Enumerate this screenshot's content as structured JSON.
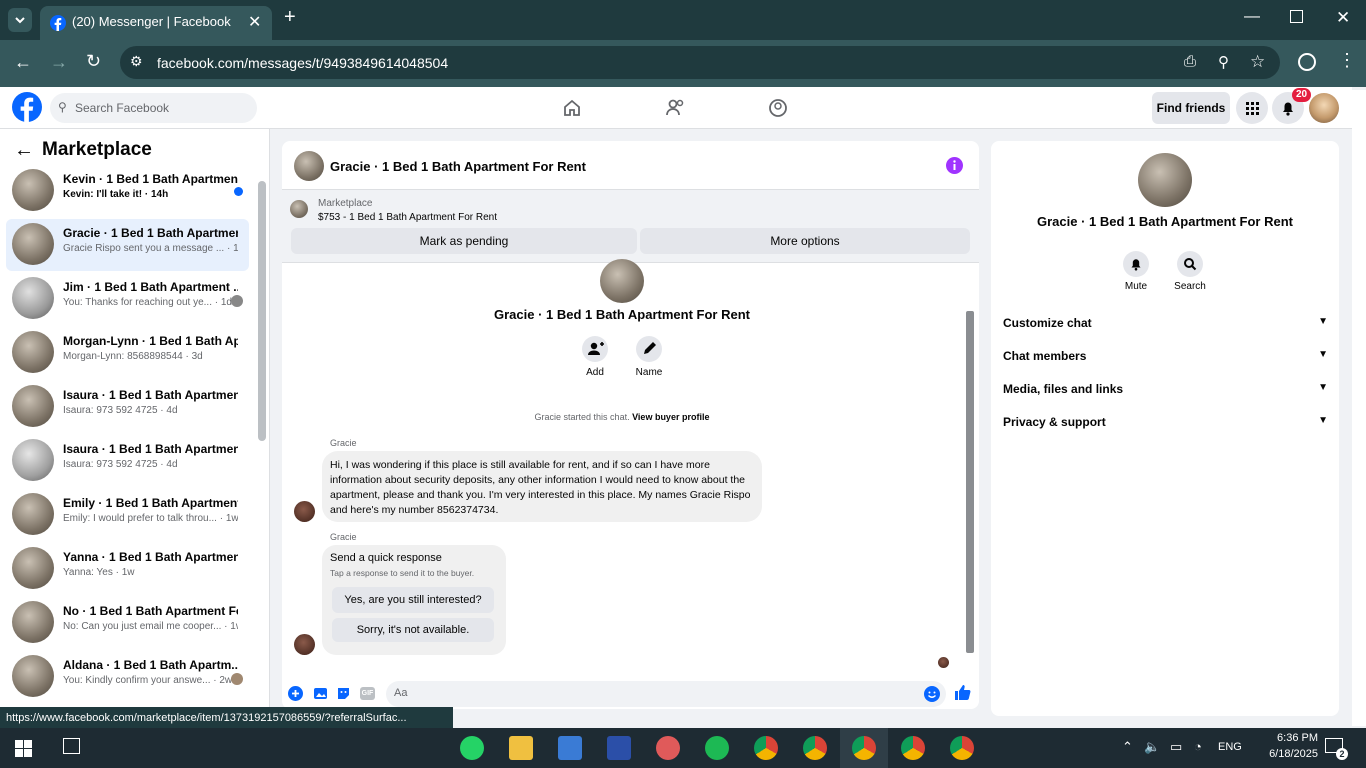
{
  "browser": {
    "tab_title": "(20) Messenger | Facebook",
    "url": "facebook.com/messages/t/9493849614048504",
    "status_url": "https://www.facebook.com/marketplace/item/1373192157086559/?referralSurfac..."
  },
  "fb_header": {
    "search_placeholder": "Search Facebook",
    "find_friends": "Find friends",
    "notification_count": "20"
  },
  "sidebar": {
    "title": "Marketplace",
    "conversations": [
      {
        "name": "Kevin · 1 Bed 1 Bath Apartmen...",
        "preview": "Kevin: I'll take it! · 14h",
        "unread": true
      },
      {
        "name": "Gracie · 1 Bed 1 Bath Apartment...",
        "preview": "Gracie Rispo sent you a message ... · 15h",
        "active": true
      },
      {
        "name": "Jim · 1 Bed 1 Bath Apartment ...",
        "preview": "You: Thanks for reaching out ye... · 1d"
      },
      {
        "name": "Morgan-Lynn · 1 Bed 1 Bath Ap...",
        "preview": "Morgan-Lynn: 8568898544 · 3d"
      },
      {
        "name": "Isaura · 1 Bed 1 Bath Apartment...",
        "preview": "Isaura: 973 592 4725 · 4d"
      },
      {
        "name": "Isaura · 1 Bed 1 Bath Apartment...",
        "preview": "Isaura: 973 592 4725 · 4d"
      },
      {
        "name": "Emily · 1 Bed 1 Bath Apartment ...",
        "preview": "Emily: I would prefer to talk throu... · 1w"
      },
      {
        "name": "Yanna · 1 Bed 1 Bath Apartment ...",
        "preview": "Yanna: Yes · 1w"
      },
      {
        "name": "No · 1 Bed 1 Bath Apartment Fo...",
        "preview": "No: Can you just email me cooper... · 1w"
      },
      {
        "name": "Aldana · 1 Bed 1 Bath Apartm...",
        "preview": "You: Kindly confirm your answe... · 2w"
      }
    ]
  },
  "chat": {
    "title": "Gracie · 1 Bed 1 Bath Apartment For Rent",
    "listing_source": "Marketplace",
    "listing_line": "$753 - 1 Bed 1 Bath Apartment For Rent",
    "mark_pending": "Mark as pending",
    "more_options": "More options",
    "intro_name": "Gracie · 1 Bed 1 Bath Apartment For Rent",
    "add_label": "Add",
    "name_label": "Name",
    "started_text": "Gracie started this chat.",
    "view_buyer": "View buyer profile",
    "sender": "Gracie",
    "message": "Hi, I was wondering if this place is still available for rent, and if so can I have more information about security deposits, any other information I would need to know about the apartment, please and thank you. I'm very interested in this place. My names Gracie Rispo and here's my number 8562374734.",
    "quick_title": "Send a quick response",
    "quick_sub": "Tap a response to send it to the buyer.",
    "quick_1": "Yes, are you still interested?",
    "quick_2": "Sorry, it's not available.",
    "composer_placeholder": "Aa"
  },
  "info_panel": {
    "title": "Gracie · 1 Bed 1 Bath Apartment For Rent",
    "mute": "Mute",
    "search": "Search",
    "sections": [
      "Customize chat",
      "Chat members",
      "Media, files and links",
      "Privacy & support"
    ]
  },
  "taskbar": {
    "time": "6:36 PM",
    "date": "6/18/2025",
    "lang": "ENG",
    "notif_count": "2"
  },
  "colors": {
    "accent": "#0866ff",
    "purple": "#a033ff",
    "chrome_dark": "#1f3a3e",
    "chrome_mid": "#35585c"
  }
}
